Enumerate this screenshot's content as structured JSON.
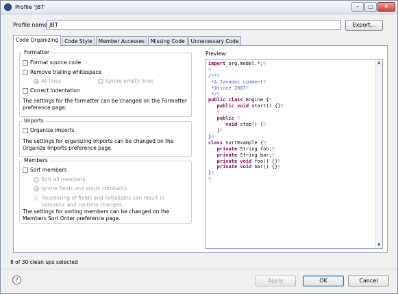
{
  "window": {
    "title": "Profile 'JBT'",
    "buttons": {
      "minimize": "–",
      "maximize": "□",
      "close": "✕"
    }
  },
  "profile": {
    "label": "Profile name:",
    "value": "JBT",
    "export_label": "Export..."
  },
  "tabs": [
    {
      "label": "Code Organizing",
      "active": true
    },
    {
      "label": "Code Style"
    },
    {
      "label": "Member Accesses"
    },
    {
      "label": "Missing Code"
    },
    {
      "label": "Unnecessary Code"
    }
  ],
  "formatter": {
    "title": "Formatter",
    "format_source": "Format source code",
    "remove_trailing": "Remove trailing whitespace",
    "all_lines": "All lines",
    "ignore_empty": "Ignore empty lines",
    "correct_indent": "Correct indentation",
    "note": "The settings for the formatter can be changed on the Formatter preference page."
  },
  "imports": {
    "title": "Imports",
    "organize": "Organize imports",
    "note": "The settings for organizing imports can be changed on the Organize Imports preference page."
  },
  "members": {
    "title": "Members",
    "sort": "Sort members",
    "sort_all": "Sort all members",
    "ignore_fields": "Ignore fields and enum constants",
    "warning": "Reordering of fields and initializers can result in semantic and runtime changes.",
    "note": "The settings for sorting members can be changed on the Members Sort Order preference page."
  },
  "preview": {
    "label": "Preview:",
    "lines": [
      "import org.model.*;¶",
      "¶",
      "/**¶",
      " *A Javadoc comment¶",
      " *@since 2007¶",
      " */¶",
      "public class Engine {¶",
      "   public void start() {}¶",
      "   ¶",
      "   public ¶",
      "      void stop() {¶",
      "   }¶",
      "}¶",
      "class SortExample {¶",
      "   private String foo;¶",
      "   private String bar;¶",
      "   private void foo() {}¶",
      "   private void bar() {}¶",
      "}¶",
      "¶"
    ]
  },
  "status": "8 of 30 clean ups selected",
  "footer": {
    "help": "?",
    "apply": "Apply",
    "ok": "OK",
    "cancel": "Cancel"
  }
}
